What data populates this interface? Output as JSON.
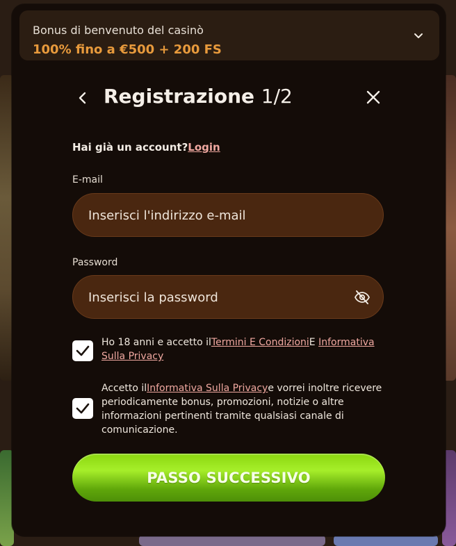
{
  "bonus": {
    "title": "Bonus di benvenuto del casinò",
    "offer": "100% fino a €500 + 200 FS"
  },
  "header": {
    "title": "Registrazione",
    "step": "1/2"
  },
  "account": {
    "prompt": "Hai già un account?",
    "login_link": "Login"
  },
  "email": {
    "label": "E-mail",
    "placeholder": "Inserisci l'indirizzo e-mail",
    "value": ""
  },
  "password": {
    "label": "Password",
    "placeholder": "Inserisci la password",
    "value": ""
  },
  "consent_terms": {
    "checked": true,
    "text_before": "Ho 18 anni e accetto il",
    "link1": "Termini E Condizioni",
    "text_between": "E",
    "link2": "Informativa Sulla Privacy"
  },
  "consent_marketing": {
    "checked": true,
    "text_before": "Accetto il",
    "link": "Informativa Sulla Privacy",
    "text_after": "e vorrei inoltre ricevere periodicamente bonus, promozioni, notizie o altre informazioni pertinenti tramite qualsiasi canale di comunicazione."
  },
  "next_button": {
    "label": "PASSO SUCCESSIVO"
  },
  "icons": {
    "bonus_toggle": "chevron-down-icon",
    "back": "chevron-left-icon",
    "close": "close-icon",
    "password_visibility": "eye-off-icon",
    "checkbox": "checkmark-icon"
  },
  "colors": {
    "modal_bg": "#140c08",
    "bonus_bg": "#2b1d12",
    "accent_orange": "#e89a3c",
    "input_bg": "#4a2710",
    "link_pink": "#f0a8a0",
    "button_green": "#7cc80f"
  }
}
